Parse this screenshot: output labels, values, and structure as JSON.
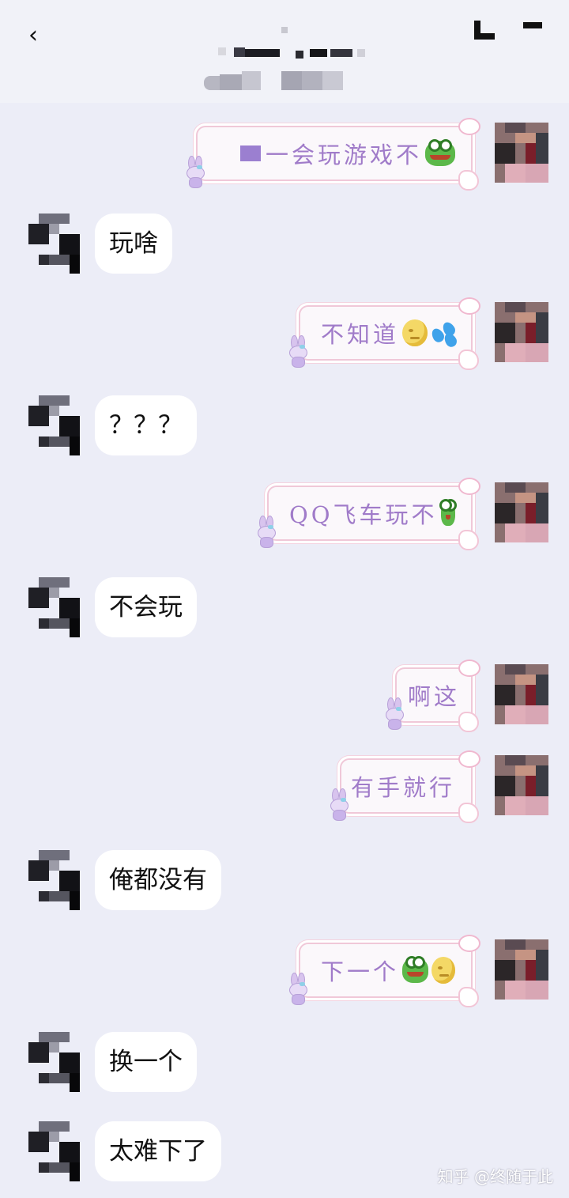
{
  "topbar": {
    "back_glyph": "‹",
    "title": "",
    "subtitle": ""
  },
  "messages": [
    {
      "side": "out",
      "text": "一会玩游戏不",
      "emoji": [
        "frog-emoji"
      ]
    },
    {
      "side": "in",
      "text": "玩啥"
    },
    {
      "side": "out",
      "text": "不知道",
      "emoji": [
        "moon-face-emoji",
        "sweat-drops-emoji"
      ]
    },
    {
      "side": "in",
      "text": "？？？"
    },
    {
      "side": "out",
      "text": "QQ飞车玩不",
      "emoji": [
        "frog-emoji"
      ]
    },
    {
      "side": "in",
      "text": "不会玩"
    },
    {
      "side": "out",
      "text": "啊这"
    },
    {
      "side": "out",
      "text": "有手就行"
    },
    {
      "side": "in",
      "text": "俺都没有"
    },
    {
      "side": "out",
      "text": "下一个",
      "emoji": [
        "frog-emoji",
        "moon-face-emoji"
      ]
    },
    {
      "side": "in",
      "text": "换一个"
    },
    {
      "side": "in",
      "text": "太难下了"
    }
  ],
  "watermark": "知乎 @终随于此",
  "colors": {
    "background": "#ecedf7",
    "incoming_bubble": "#ffffff",
    "outgoing_text": "#a07bc9",
    "outgoing_border": "#f0c8d8"
  }
}
